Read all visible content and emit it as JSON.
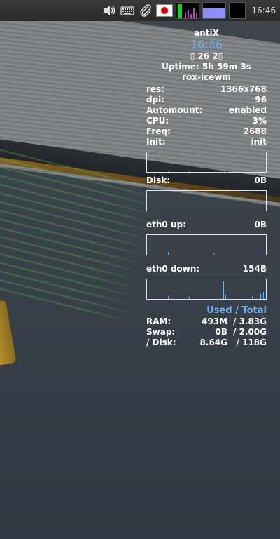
{
  "panel": {
    "clock": "16:46",
    "icons": [
      "volume-icon",
      "keyboard-icon",
      "paperclip-icon",
      "japan-flag-icon",
      "cpu-monitor",
      "memory-monitor",
      "network-monitor"
    ]
  },
  "conky": {
    "hostname": "antiX",
    "time": "16:46",
    "date": "▯ 26  2▯",
    "uptime_label": "Uptime:",
    "uptime": "5h 59m 3s",
    "wm": "rox-icewm",
    "stats": [
      {
        "label": "res:",
        "value": "1366x768"
      },
      {
        "label": "dpi:",
        "value": "96"
      },
      {
        "label": "Automount:",
        "value": "enabled"
      },
      {
        "label": "CPU:",
        "value": "3%"
      },
      {
        "label": "Freq:",
        "value": "2688"
      },
      {
        "label": "Init:",
        "value": "init"
      }
    ],
    "disk_label": "Disk:",
    "disk_value": "0B",
    "eth0_up_label": "eth0 up:",
    "eth0_up_value": "0B",
    "eth0_down_label": "eth0 down:",
    "eth0_down_value": "154B",
    "usage_header_used": "Used",
    "usage_header_sep": " / ",
    "usage_header_total": "Total",
    "usage": [
      {
        "label": "RAM:",
        "used": "493M",
        "total": "/ 3.83G"
      },
      {
        "label": "Swap:",
        "used": "0B",
        "total": "/ 2.00G"
      },
      {
        "label": "/ Disk:",
        "used": "8.64G",
        "total": "/ 118G"
      }
    ],
    "accent_color": "#6fb0ef"
  }
}
